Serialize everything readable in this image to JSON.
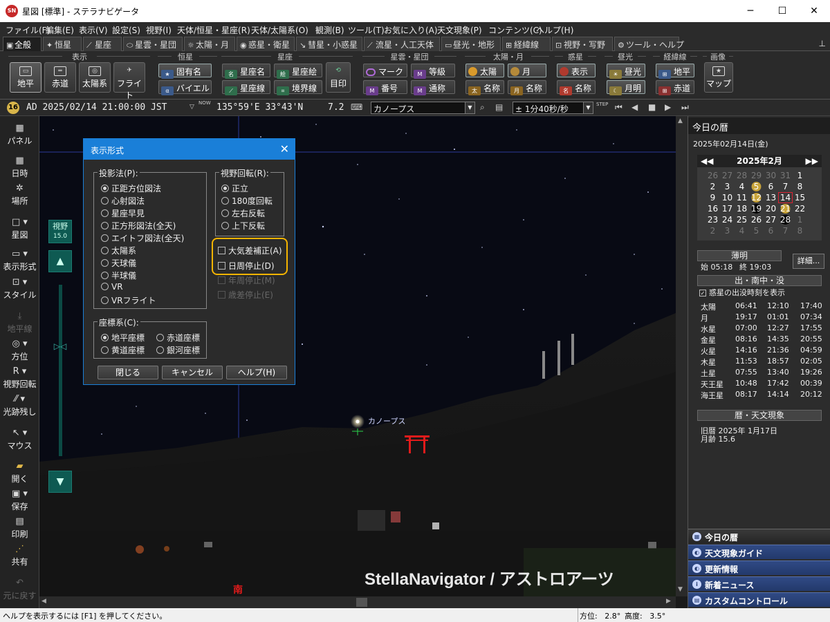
{
  "window": {
    "logo": "SN",
    "title": "星図 [標準] - ステラナビゲータ",
    "minimize": "─",
    "maximize": "☐",
    "close": "✕"
  },
  "menu": [
    "ファイル(F)",
    "編集(E)",
    "表示(V)",
    "設定(S)",
    "視野(I)",
    "天体/恒星・星座(R)",
    "天体/太陽系(O)",
    "観測(B)",
    "ツール(T)",
    "お気に入り(A)",
    "天文現象(P)",
    "コンテンツ(C)",
    "ヘルプ(H)"
  ],
  "tabs": [
    "全般",
    "恒星",
    "星座",
    "星雲・星団",
    "太陽・月",
    "惑星・衛星",
    "彗星・小惑星",
    "流星・人工天体",
    "昼光・地形",
    "経緯線",
    "視野・写野",
    "ツール・ヘルプ"
  ],
  "ribbon": {
    "groups": [
      "表示",
      "恒星",
      "星座",
      "星雲・星団",
      "太陽・月",
      "惑星",
      "昼光",
      "経緯線",
      "画像"
    ],
    "view_buttons": [
      "地平",
      "赤道",
      "太陽系",
      "フライト"
    ],
    "star_buttons": [
      "固有名",
      "バイエル"
    ],
    "const_buttons": [
      "星座名",
      "星座絵",
      "星座線",
      "境界線",
      "目印"
    ],
    "neb_buttons": [
      "マーク",
      "等級",
      "番号",
      "通称"
    ],
    "sun_moon_buttons": [
      "太陽",
      "月",
      "名称",
      "名称"
    ],
    "planet_buttons": [
      "表示",
      "名称"
    ],
    "daylight_buttons": [
      "昼光",
      "月明"
    ],
    "grid_buttons": [
      "地平",
      "赤道"
    ],
    "image_buttons": [
      "マップ"
    ]
  },
  "toolbar": {
    "zoom_badge": "16",
    "datetime": "AD 2025/02/14 21:00:00 JST",
    "now": "NOW",
    "coords": "135°59'E 33°43'N",
    "fov": "7.2",
    "object_select": "カノープス",
    "step_select": "± 1分40秒/秒",
    "step_label": "STEP"
  },
  "left_toolbar": [
    "パネル",
    "日時",
    "場所",
    "星図",
    "表示形式",
    "スタイル",
    "地平線",
    "方位",
    "視野回転",
    "光跡残し",
    "マウス",
    "開く",
    "保存",
    "印刷",
    "共有",
    "元に戻す"
  ],
  "sky": {
    "fov_label": "視野",
    "fov_value": "15.0",
    "star_label": "カノープス",
    "south_label": "南",
    "watermark": "StellaNavigator / アストロアーツ"
  },
  "dialog": {
    "title": "表示形式",
    "projection_title": "投影法(P):",
    "projections": [
      "正距方位図法",
      "心射図法",
      "星座早見",
      "正方形図法(全天)",
      "エイトフ図法(全天)",
      "太陽系",
      "天球儀",
      "半球儀",
      "VR",
      "VRフライト"
    ],
    "rotation_title": "視野回転(R):",
    "rotations": [
      "正立",
      "180度回転",
      "左右反転",
      "上下反転"
    ],
    "checks": [
      "大気差補正(A)",
      "日周停止(D)",
      "年周停止(M)",
      "歳差停止(E)"
    ],
    "coord_title": "座標系(C):",
    "coords": [
      "地平座標",
      "赤道座標",
      "黄道座標",
      "銀河座標"
    ],
    "buttons": [
      "閉じる",
      "キャンセル",
      "ヘルプ(H)"
    ]
  },
  "right_panel": {
    "header": "今日の暦",
    "date": "2025年02月14日(金)",
    "calendar_title": "2025年2月",
    "cal_days": [
      "26",
      "27",
      "28",
      "29",
      "30",
      "31",
      "1",
      "2",
      "3",
      "4",
      "5",
      "6",
      "7",
      "8",
      "9",
      "10",
      "11",
      "12",
      "13",
      "14",
      "15",
      "16",
      "17",
      "18",
      "19",
      "20",
      "21",
      "22",
      "23",
      "24",
      "25",
      "26",
      "27",
      "28",
      "1",
      "2",
      "3",
      "4",
      "5",
      "6",
      "7",
      "8"
    ],
    "twilight_label": "薄明",
    "twilight_start": "始 05:18",
    "twilight_end": "終 19:03",
    "detail_button": "詳細...",
    "rise_section": "出・南中・没",
    "rise_check": "惑星の出没時刻を表示",
    "rise_table": [
      [
        "太陽",
        "06:41",
        "12:10",
        "17:40"
      ],
      [
        "月",
        "19:17",
        "01:01",
        "07:34"
      ],
      [
        "水星",
        "07:00",
        "12:27",
        "17:55"
      ],
      [
        "金星",
        "08:16",
        "14:35",
        "20:55"
      ],
      [
        "火星",
        "14:16",
        "21:36",
        "04:59"
      ],
      [
        "木星",
        "11:53",
        "18:57",
        "02:05"
      ],
      [
        "土星",
        "07:55",
        "13:40",
        "19:26"
      ],
      [
        "天王星",
        "10:48",
        "17:42",
        "00:39"
      ],
      [
        "海王星",
        "08:17",
        "14:14",
        "20:12"
      ]
    ],
    "calendar_section": "暦・天文現象",
    "lunar_date": "旧暦  2025年 1月17日",
    "moon_age": "月齢 15.6",
    "nav": [
      "今日の暦",
      "天文現象ガイド",
      "更新情報",
      "新着ニュース",
      "カスタムコントロール"
    ]
  },
  "statusbar": {
    "help": "ヘルプを表示するには [F1] を押してください。",
    "azimuth": "方位:   2.8°",
    "altitude": "高度:   3.5°"
  }
}
